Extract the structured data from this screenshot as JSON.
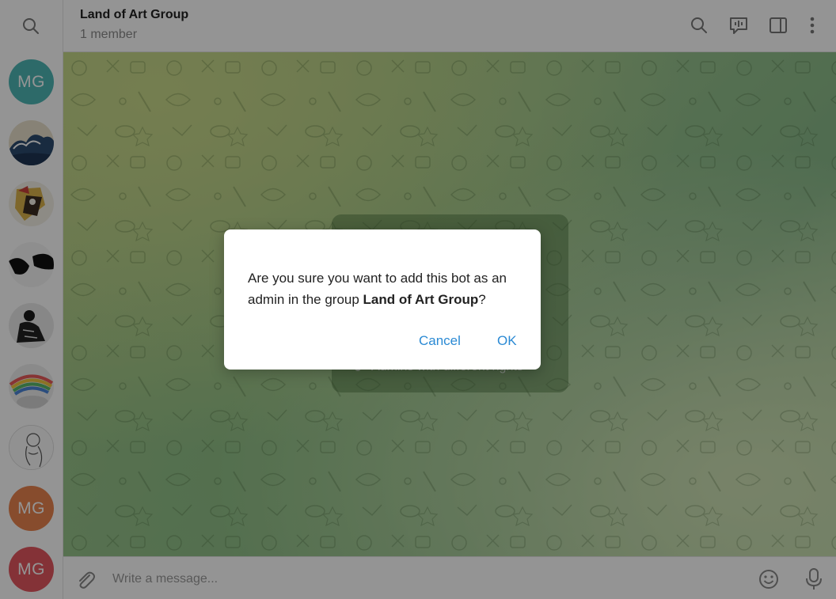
{
  "header": {
    "title": "Land of Art Group",
    "subtitle": "1 member"
  },
  "rail": {
    "avatars": [
      {
        "initials": "MG",
        "color": "#4fb7b5"
      },
      {
        "kind": "image",
        "icon": "great-wave-avatar"
      },
      {
        "kind": "image",
        "icon": "cubist-portrait-avatar"
      },
      {
        "kind": "image",
        "icon": "abstract-black-avatar"
      },
      {
        "kind": "image",
        "icon": "figure-drawing-avatar"
      },
      {
        "kind": "image",
        "icon": "rainbow-art-avatar"
      },
      {
        "kind": "image",
        "icon": "line-sketch-avatar"
      },
      {
        "initials": "MG",
        "color": "#e8834f"
      },
      {
        "initials": "MG",
        "color": "#e45660"
      }
    ]
  },
  "background_card": {
    "bullet_text": "Admins with different rights"
  },
  "composer": {
    "placeholder": "Write a message..."
  },
  "dialog": {
    "text_before": "Are you sure you want to add this bot as an admin in the group ",
    "group_name": "Land of Art Group",
    "text_after": "?",
    "cancel_label": "Cancel",
    "ok_label": "OK"
  },
  "colors": {
    "accent": "#2b8ad4",
    "mg_teal": "#4fb7b5",
    "mg_orange": "#e8834f",
    "mg_red": "#e45660"
  }
}
